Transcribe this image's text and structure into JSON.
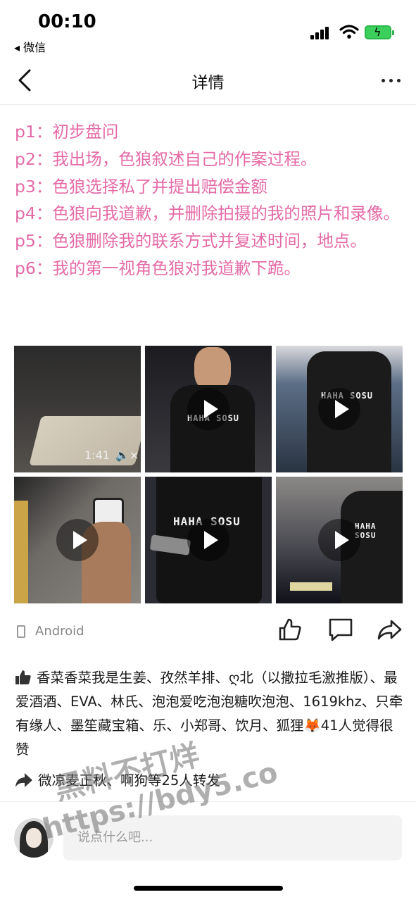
{
  "status_bar": {
    "time": "00:10",
    "back_app": "◂ 微信"
  },
  "nav": {
    "title": "详情"
  },
  "post": {
    "lines": [
      "p1：初步盘问",
      "p2：我出场，色狼叙述自己的作案过程。",
      "p3：色狼选择私了并提出赔偿金额",
      "p4：色狼向我道歉，并删除拍摄的我的照片和录像。",
      "p5：色狼删除我的联系方式并复述时间，地点。",
      "p6：我的第一视角色狼对我道歉下跪。"
    ]
  },
  "media": {
    "first_duration": "1:41",
    "shirt_text": "HAHA SOSU"
  },
  "device": {
    "label": "Android"
  },
  "likes": {
    "text": "香菜香菜我是生姜、孜然羊排、ღ北（以撒拉毛激推版）、最爱酒酒、EVA、林氏、泡泡爱吃泡泡糖吹泡泡、1619khz、只牵有缘人、墨笙藏宝箱、乐、小郑哥、饮月、狐狸🦊41人觉得很赞"
  },
  "reposts": {
    "text": "微凉麦正秋、啊狗等25人转发"
  },
  "comment": {
    "placeholder": "说点什么吧..."
  },
  "watermark": {
    "line1": "黑料不打烊",
    "line2": "https://bdy5.co"
  },
  "colors": {
    "post_text": "#e46aa6",
    "accent_battery": "#3bd05c"
  }
}
